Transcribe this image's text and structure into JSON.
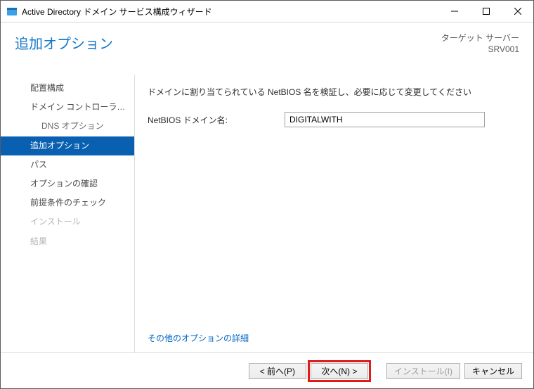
{
  "window": {
    "title": "Active Directory ドメイン サービス構成ウィザード"
  },
  "header": {
    "page_title": "追加オプション",
    "target_label": "ターゲット サーバー",
    "target_server": "SRV001"
  },
  "sidebar": {
    "steps": [
      {
        "label": "配置構成",
        "kind": "normal"
      },
      {
        "label": "ドメイン コントローラー オプション",
        "kind": "normal"
      },
      {
        "label": "DNS オプション",
        "kind": "sub"
      },
      {
        "label": "追加オプション",
        "kind": "current"
      },
      {
        "label": "パス",
        "kind": "normal"
      },
      {
        "label": "オプションの確認",
        "kind": "normal"
      },
      {
        "label": "前提条件のチェック",
        "kind": "normal"
      },
      {
        "label": "インストール",
        "kind": "disabled"
      },
      {
        "label": "結果",
        "kind": "disabled"
      }
    ]
  },
  "content": {
    "instruction": "ドメインに割り当てられている NetBIOS 名を検証し、必要に応じて変更してください",
    "netbios_label": "NetBIOS ドメイン名:",
    "netbios_value": "DIGITALWITH",
    "more_link": "その他のオプションの詳細"
  },
  "footer": {
    "prev": "< 前へ(P)",
    "next": "次へ(N) >",
    "install": "インストール(I)",
    "cancel": "キャンセル"
  }
}
